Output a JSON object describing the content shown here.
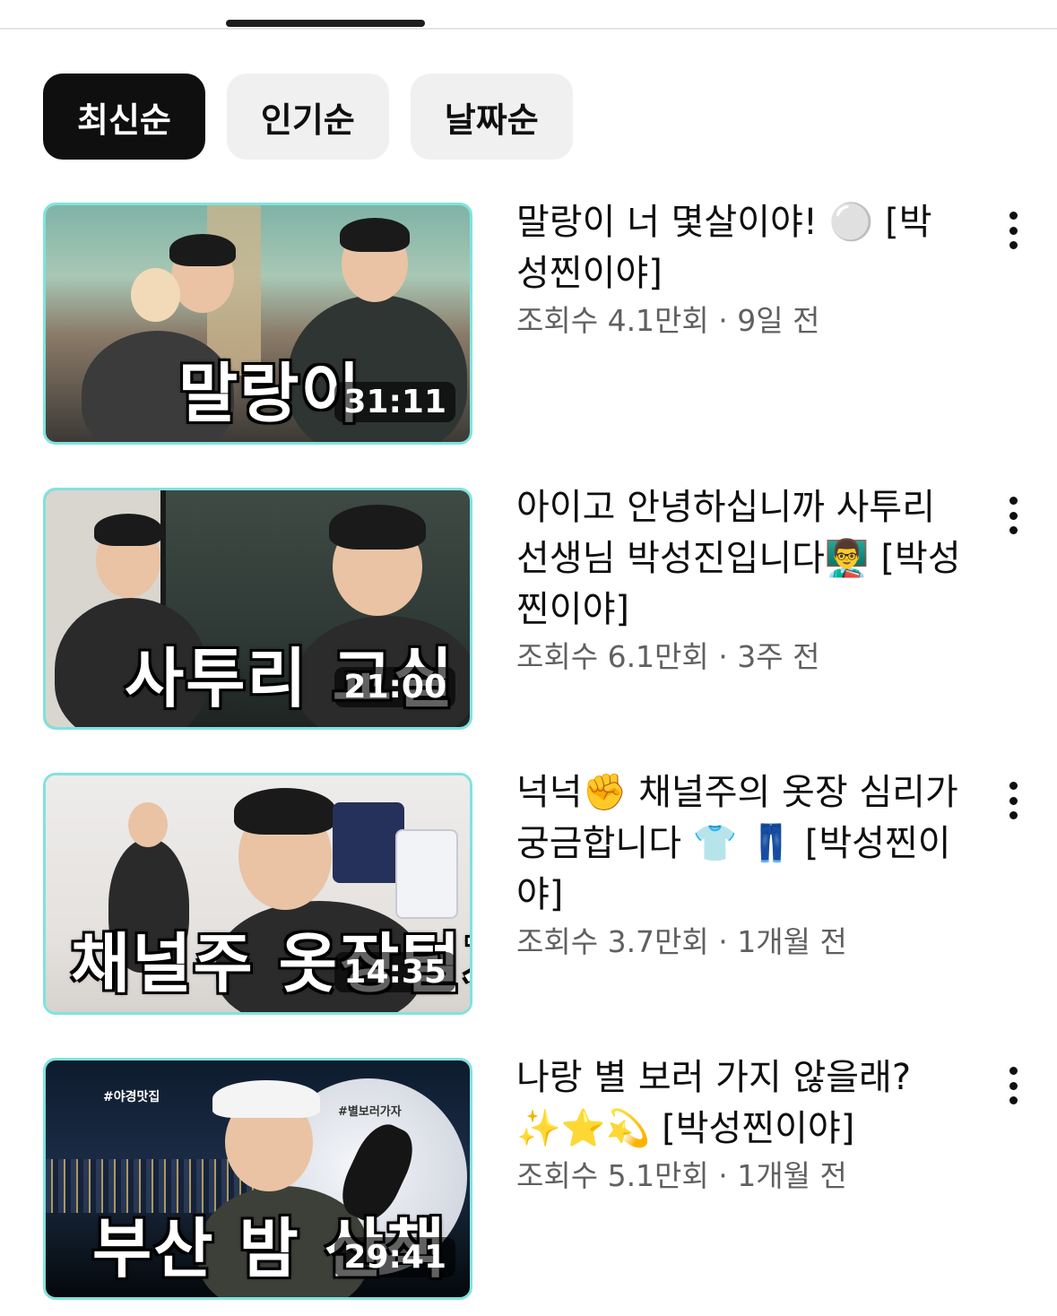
{
  "filters": [
    {
      "label": "최신순",
      "active": true
    },
    {
      "label": "인기순",
      "active": false
    },
    {
      "label": "날짜순",
      "active": false
    }
  ],
  "videos": [
    {
      "thumb_caption": "말랑이",
      "duration": "31:11",
      "title": "말랑이 너 몇살이야! ⚪️ [박성찐이야]",
      "stats": "조회수 4.1만회 · 9일 전"
    },
    {
      "thumb_caption": "사투리 교실",
      "duration": "21:00",
      "title": "아이고 안녕하십니까 사투리 선생님 박성진입니다👨‍🏫 [박성찐이야]",
      "stats": "조회수 6.1만회 · 3주 전"
    },
    {
      "thumb_caption": "채널주 옷장털기",
      "duration": "14:35",
      "title": "넉넉✊  채널주의 옷장 심리가 궁금합니다 👕 👖 [박성찐이야]",
      "stats": "조회수 3.7만회 · 1개월 전"
    },
    {
      "thumb_caption": "부산 밤 산책",
      "duration": "29:41",
      "title": "나랑 별 보러 가지 않을래? ✨⭐️💫  [박성찐이야]",
      "stats": "조회수 5.1만회 · 1개월 전",
      "thumb_tags": [
        "#야경맛집",
        "#별보러가자"
      ]
    }
  ]
}
